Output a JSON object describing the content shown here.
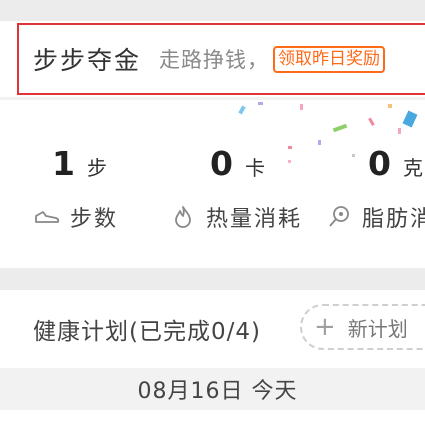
{
  "promo": {
    "title": "步步夺金",
    "subtitle": "走路挣钱，",
    "button_label": "领取昨日奖励"
  },
  "stats": [
    {
      "value": "1",
      "unit": "步",
      "label": "步数",
      "icon": "shoe-icon"
    },
    {
      "value": "0",
      "unit": "卡",
      "label": "热量消耗",
      "icon": "flame-icon"
    },
    {
      "value": "0",
      "unit": "克",
      "label": "脂肪消耗",
      "icon": "fat-icon"
    }
  ],
  "plan": {
    "title": "健康计划(已完成0/4)",
    "new_plan_label": "新计划"
  },
  "date": {
    "text": "08月16日 今天"
  },
  "colors": {
    "promo_border": "#e0343a",
    "promo_button": "#ff6a1a",
    "background_strip": "#ececec"
  }
}
